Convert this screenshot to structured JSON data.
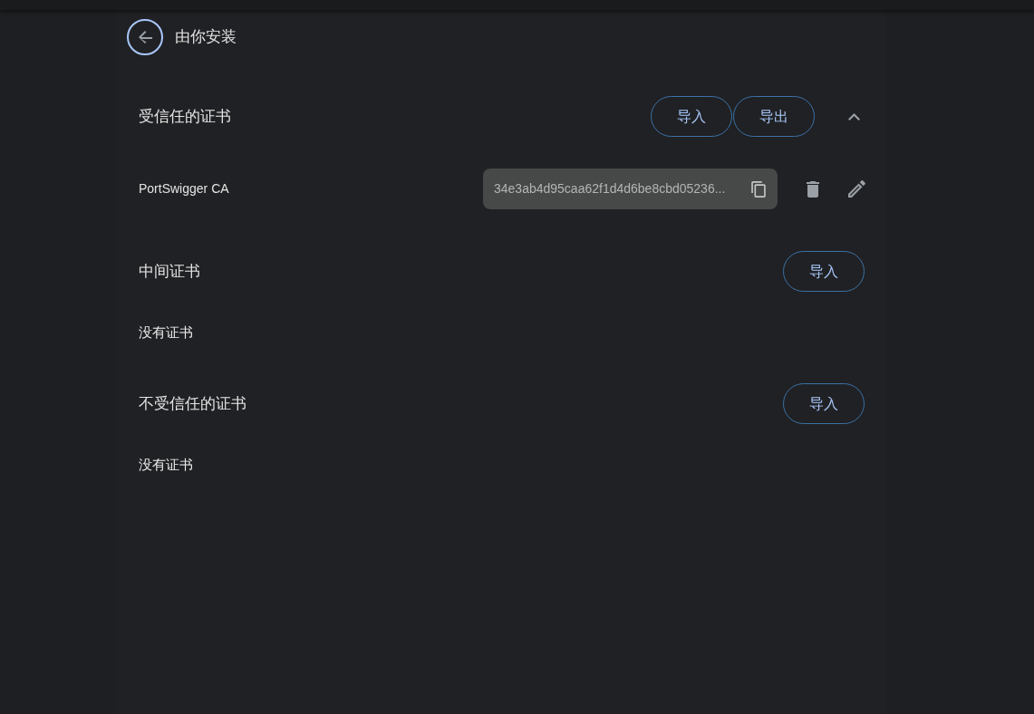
{
  "header": {
    "back_button": {
      "focused": true
    },
    "title": "由你安装"
  },
  "sections": [
    {
      "title": "受信任的证书",
      "buttons": [
        "导入",
        "导出"
      ],
      "toggle": {
        "expanded": true
      },
      "certificates": [
        {
          "name": "PortSwigger CA",
          "fingerprint": "34e3ab4d95caa62f1d4d6be8cbd05236..."
        }
      ]
    },
    {
      "title": "中间证书",
      "buttons": [
        "导入"
      ],
      "empty_text": "没有证书"
    },
    {
      "title": "不受信任的证书",
      "buttons": [
        "导入"
      ],
      "empty_text": "没有证书"
    }
  ]
}
